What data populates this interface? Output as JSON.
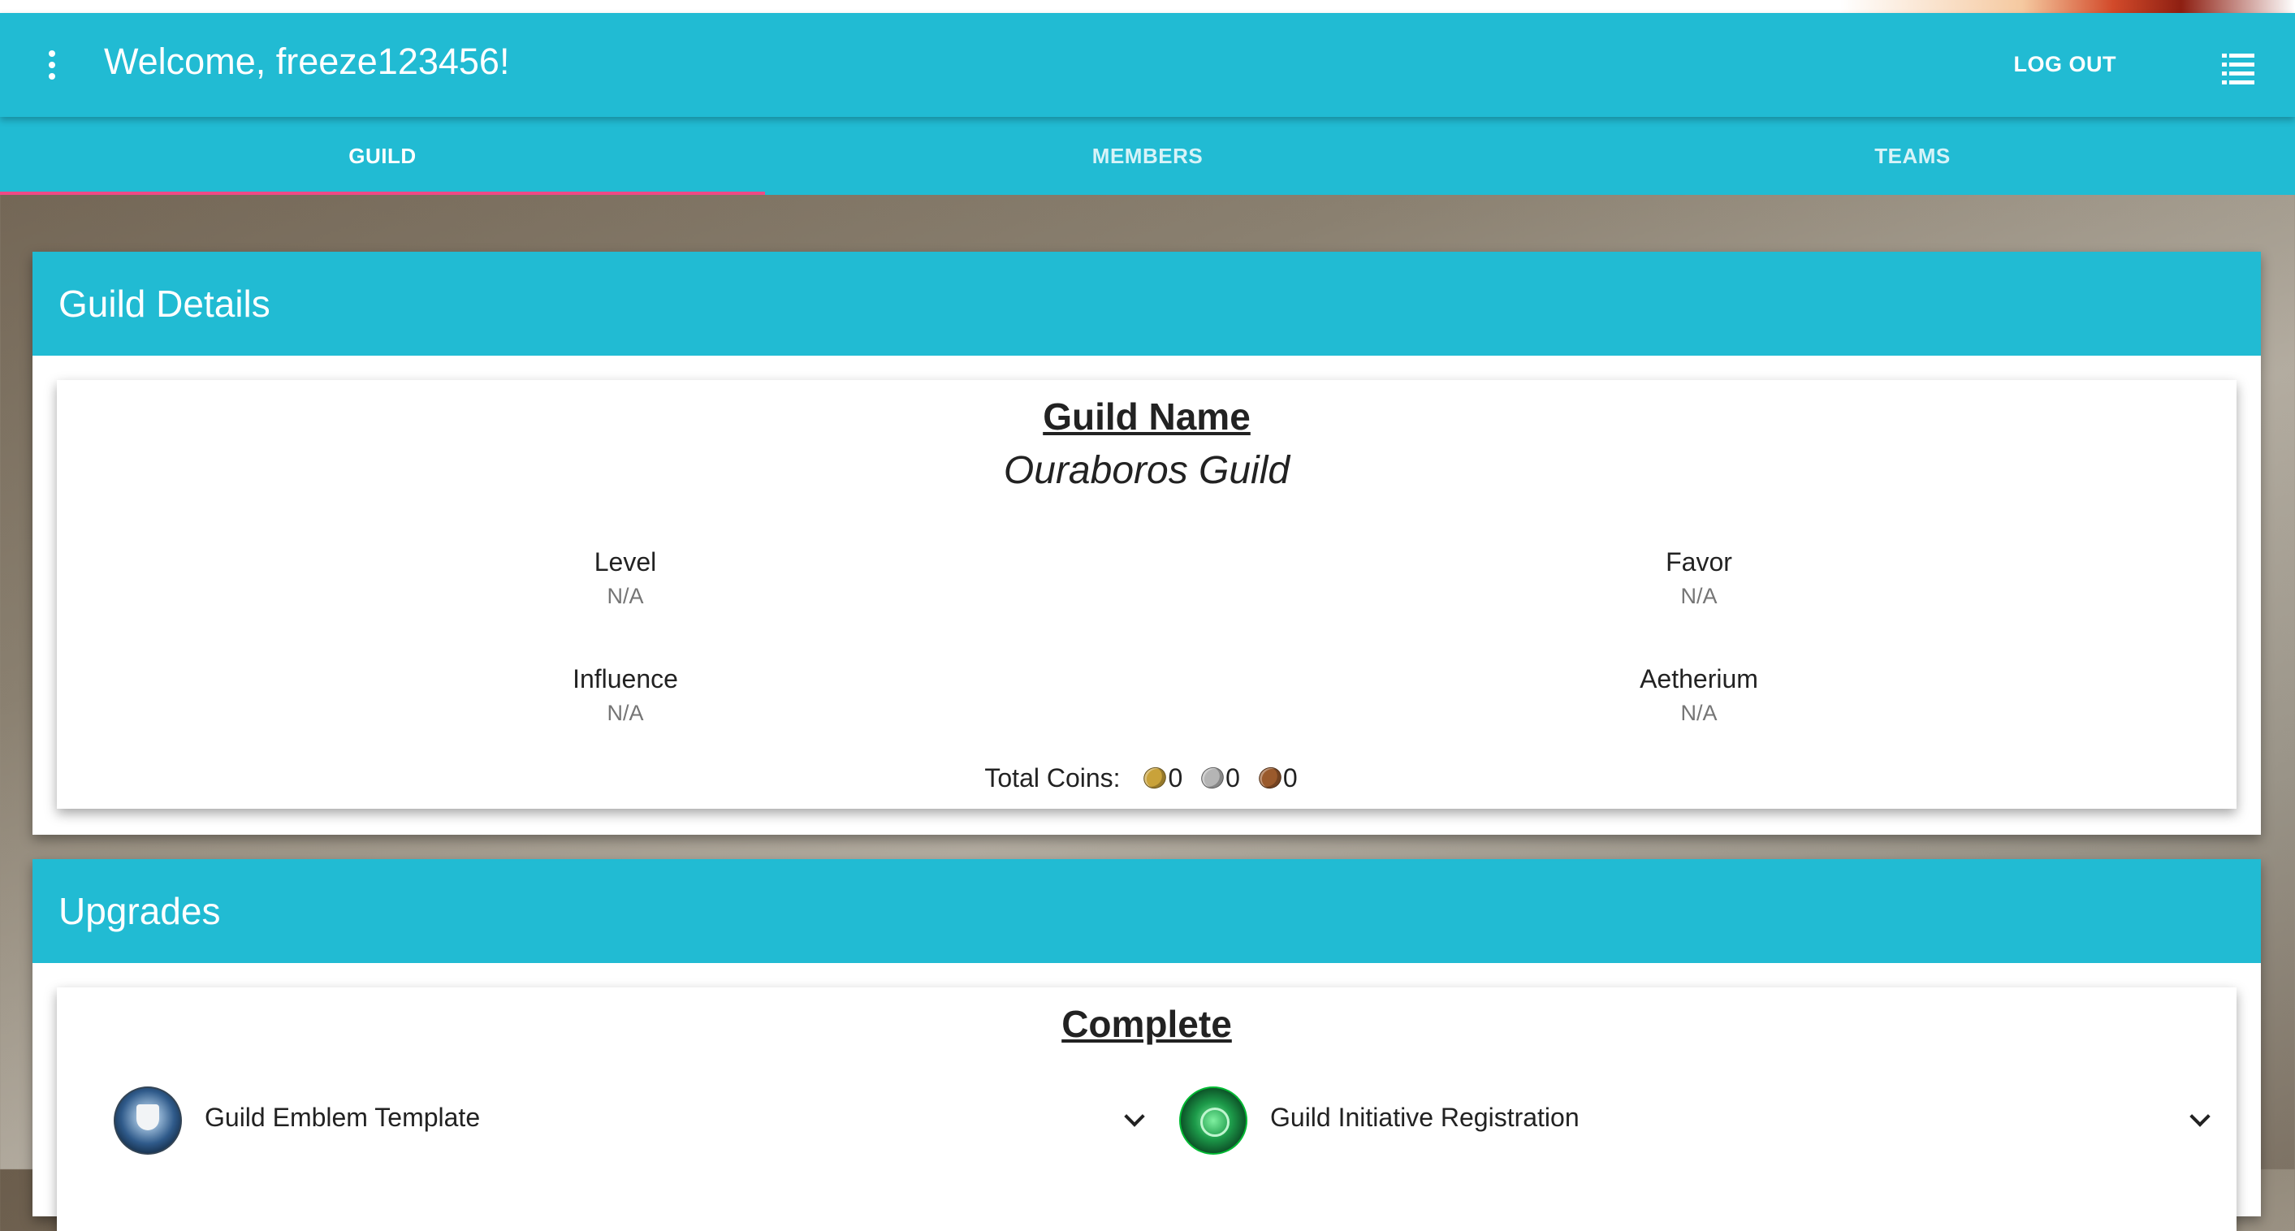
{
  "header": {
    "welcome": "Welcome, freeze123456!",
    "logout": "LOG OUT",
    "menu_icon": "more-vert-icon",
    "list_icon": "list-icon"
  },
  "tabs": [
    {
      "label": "GUILD",
      "active": true
    },
    {
      "label": "MEMBERS",
      "active": false
    },
    {
      "label": "TEAMS",
      "active": false
    }
  ],
  "guild_details": {
    "title": "Guild Details",
    "name_label": "Guild Name",
    "name_value": "Ouraboros Guild",
    "level": {
      "label": "Level",
      "value": "N/A"
    },
    "favor": {
      "label": "Favor",
      "value": "N/A"
    },
    "influence": {
      "label": "Influence",
      "value": "N/A"
    },
    "aetherium": {
      "label": "Aetherium",
      "value": "N/A"
    },
    "coins": {
      "label": "Total Coins:",
      "gold": "0",
      "silver": "0",
      "copper": "0"
    }
  },
  "upgrades": {
    "title": "Upgrades",
    "section": "Complete",
    "items": [
      {
        "name": "Guild Emblem Template",
        "icon": "guild-emblem-icon"
      },
      {
        "name": "Guild Initiative Registration",
        "icon": "guild-initiative-icon"
      }
    ]
  },
  "colors": {
    "primary": "#21bbd3",
    "tab_indicator": "#ee4a85",
    "muted_text": "#757575"
  }
}
